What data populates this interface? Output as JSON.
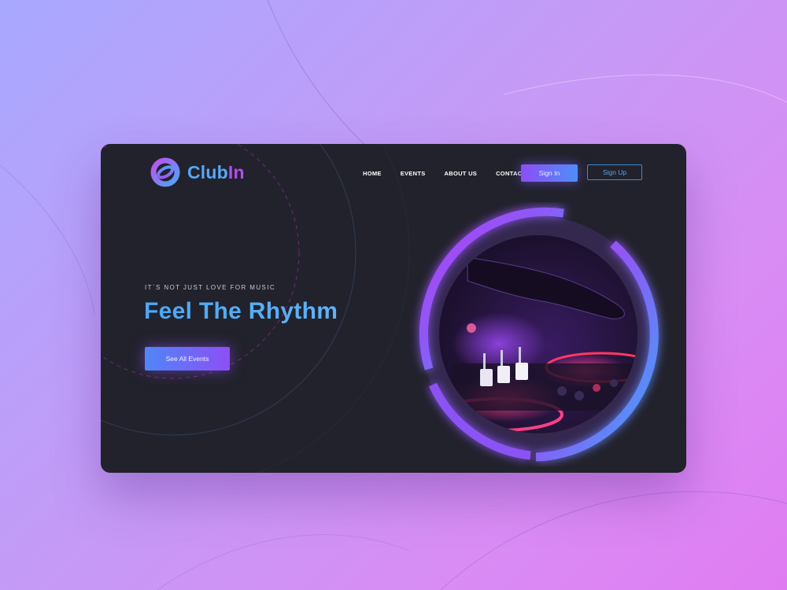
{
  "brand": {
    "name_part1": "Club",
    "name_part2": "In",
    "logo_icon": "ring-logo-icon"
  },
  "nav": {
    "items": [
      {
        "label": "HOME"
      },
      {
        "label": "EVENTS"
      },
      {
        "label": "ABOUT US"
      },
      {
        "label": "CONTACT"
      }
    ]
  },
  "auth": {
    "signin_label": "Sign In",
    "signup_label": "Sign Up"
  },
  "hero": {
    "eyebrow": "IT`S NOT JUST LOVE FOR MUSIC",
    "headline": "Feel The Rhythm",
    "cta_label": "See All Events",
    "image_subject": "dj-mixer-photo"
  },
  "colors": {
    "background_start": "#a8a8ff",
    "background_end": "#e07cf2",
    "card": "#22222c",
    "accent_blue": "#4aa7f6",
    "accent_purple": "#9b45f2"
  }
}
